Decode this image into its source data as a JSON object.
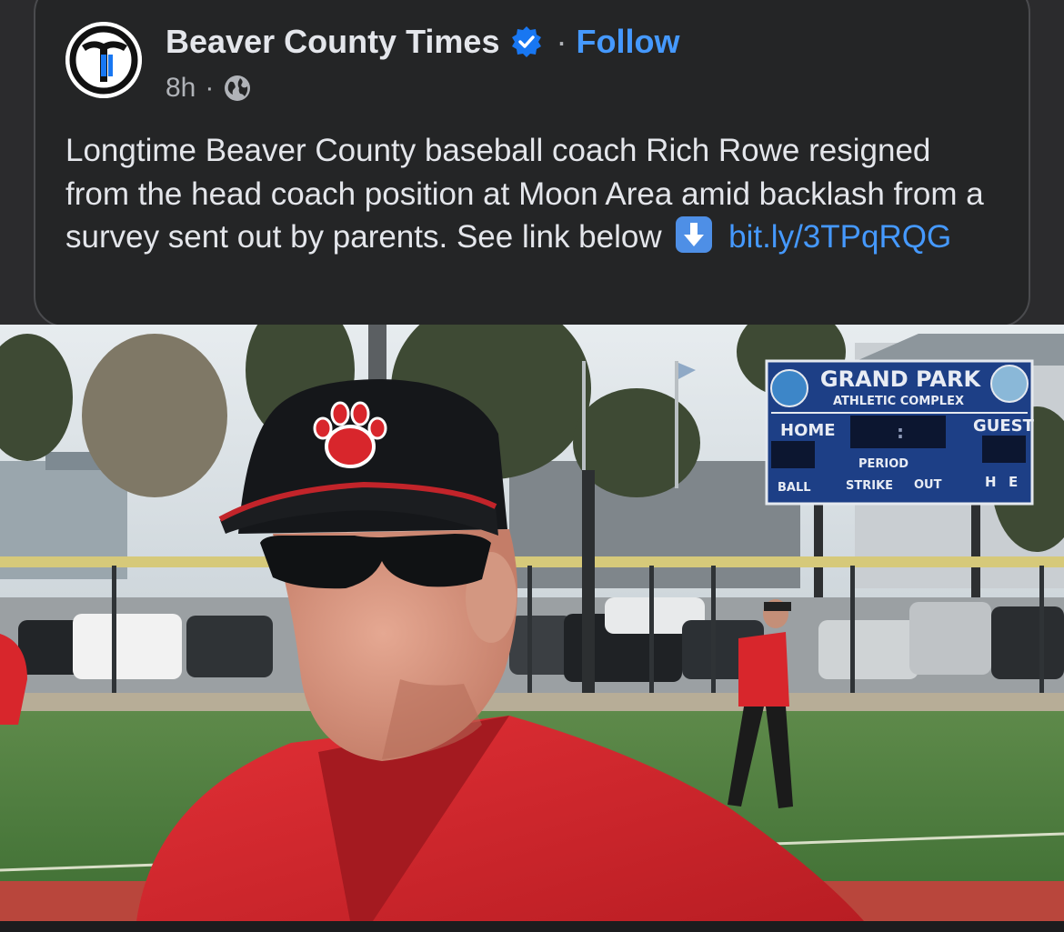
{
  "post": {
    "page_name": "Beaver County Times",
    "follow_label": "Follow",
    "separator": "·",
    "time": "8h",
    "text": "Longtime Beaver County baseball coach Rich Rowe resigned from the head coach position at Moon Area amid backlash from a survey sent out by parents. See link below",
    "link": "bit.ly/3TPqRQG",
    "icons": {
      "avatar": "times-logo-icon",
      "verified": "verified-badge-icon",
      "audience": "globe-icon",
      "emoji": "down-arrow-emoji-icon"
    }
  },
  "photo": {
    "scoreboard": {
      "title": "GRAND PARK",
      "subtitle": "ATHLETIC COMPLEX",
      "home": "HOME",
      "guest": "GUEST",
      "colon": ":",
      "period": "PERIOD",
      "ball": "BALL",
      "strike": "STRIKE",
      "out": "OUT",
      "h": "H",
      "e": "E"
    }
  },
  "colors": {
    "background": "#2b2b2d",
    "link": "#4599ff",
    "follow": "#4599ff",
    "verified": "#1877f2",
    "jersey": "#d8262c"
  }
}
